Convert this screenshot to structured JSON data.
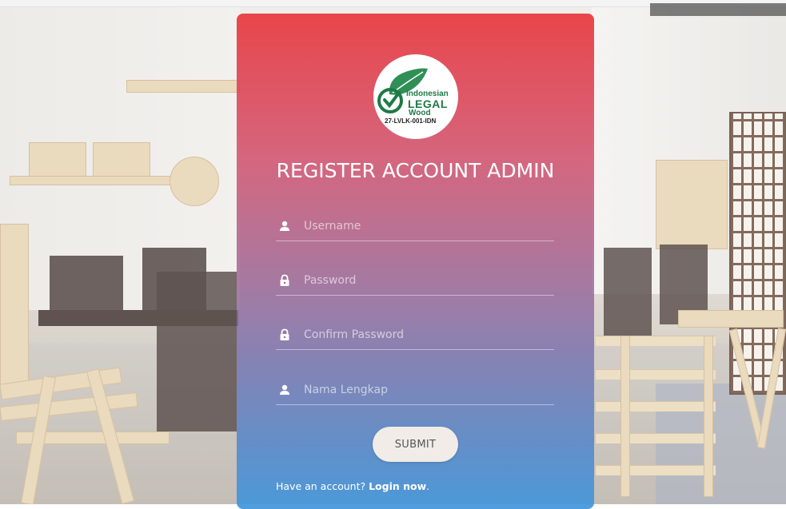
{
  "form": {
    "title": "REGISTER ACCOUNT ADMIN",
    "fields": [
      {
        "placeholder": "Username",
        "value": "",
        "icon": "user-icon"
      },
      {
        "placeholder": "Password",
        "value": "",
        "icon": "lock-icon"
      },
      {
        "placeholder": "Confirm Password",
        "value": "",
        "icon": "lock-icon"
      },
      {
        "placeholder": "Nama Lengkap",
        "value": "",
        "icon": "user-icon"
      }
    ],
    "submit_label": "SUBMIT",
    "footer_prefix": "Have an account?",
    "footer_link": "Login now",
    "footer_suffix": "."
  },
  "logo": {
    "line1": "Indonesian",
    "line2": "LEGAL",
    "line3": "Wood",
    "line4": "27-LVLK-001-IDN"
  },
  "colors": {
    "card_top": "#e8373c",
    "card_bottom": "#4096dc",
    "logo_green": "#1e7a45",
    "button_bg": "#f1ece8"
  }
}
